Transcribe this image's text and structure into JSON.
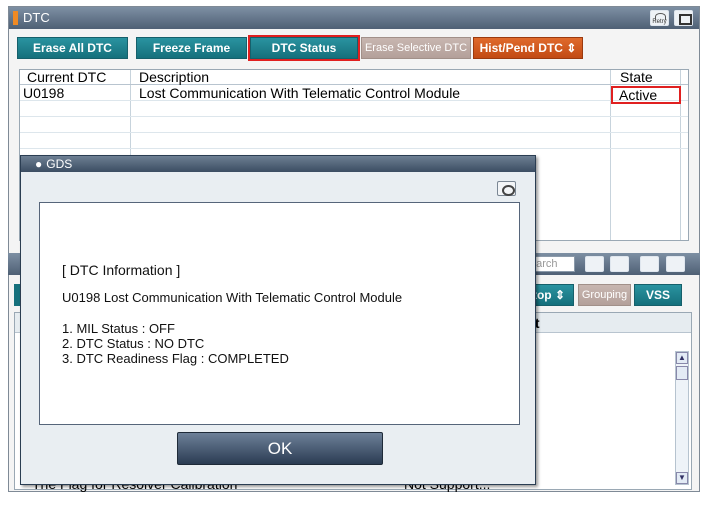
{
  "window": {
    "title": "DTC",
    "retry_label": "Retry"
  },
  "toolbar": {
    "erase_all": "Erase All DTC",
    "freeze_frame": "Freeze Frame",
    "dtc_status": "DTC Status",
    "erase_selective": "Erase Selective DTC",
    "hist_pend": "Hist/Pend DTC"
  },
  "dtc_table": {
    "headers": {
      "current": "Current DTC",
      "description": "Description",
      "state": "State"
    },
    "rows": [
      {
        "code": "U0198",
        "description": "Lost Communication With Telematic Control Module",
        "state": "Active"
      }
    ]
  },
  "lower_panel": {
    "search_placeholder": "earch",
    "stop_label": "top",
    "grouping_label": "Grouping",
    "vss_label": "VSS",
    "unit_header": "it",
    "partial_row_name": "The Flag for Resolver Calibration",
    "partial_row_value": "Not Support..."
  },
  "gds_dialog": {
    "title": "GDS",
    "info_header": "[ DTC Information ]",
    "dtc_line": "U0198 Lost Communication With Telematic Control Module",
    "mil_status": "1. MIL Status : OFF",
    "dtc_status": "2. DTC Status : NO DTC",
    "readiness": "3. DTC Readiness Flag : COMPLETED",
    "ok_label": "OK"
  },
  "colors": {
    "teal": "#15707c",
    "orange": "#c24a14",
    "highlight": "#e02020",
    "titlebar": "#4f6075"
  }
}
